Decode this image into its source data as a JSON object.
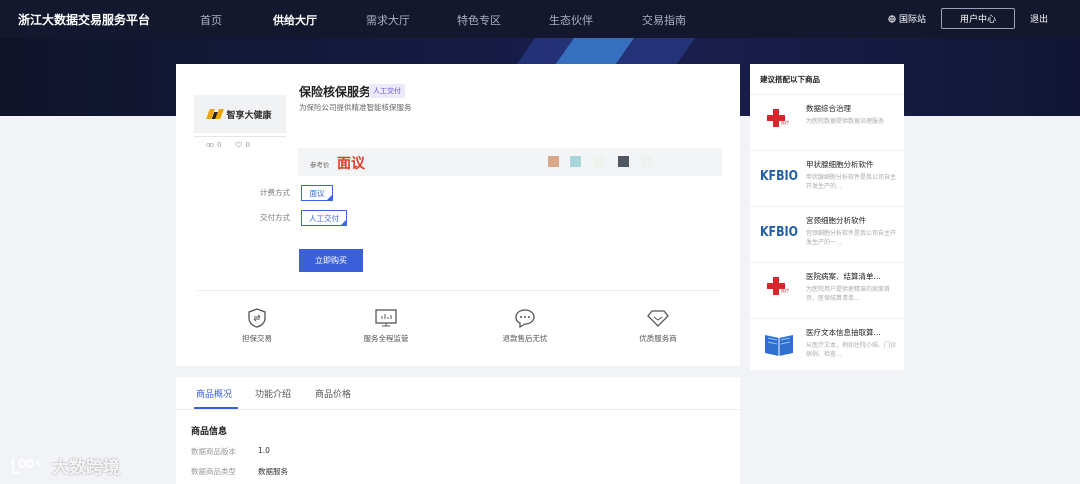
{
  "header": {
    "brand": "浙江大数据交易服务平台",
    "nav": [
      "首页",
      "供给大厅",
      "需求大厅",
      "特色专区",
      "生态伙伴",
      "交易指南"
    ],
    "active_nav": "供给大厅",
    "international": "国际站",
    "user_center": "用户中心",
    "logout": "退出"
  },
  "product": {
    "logo_text": "智享大健康",
    "views": "0",
    "favorites": "0",
    "title": "保险核保服务",
    "tag": "人工交付",
    "subtitle": "为保险公司提供精准智能核保服务",
    "price_label": "参考价",
    "price": "面议",
    "swatch_colors": [
      "#d9a88a",
      "#a9d6da",
      "#eef3ee",
      "#505863",
      "#eef2ef"
    ],
    "billing_label": "计费方式",
    "billing_option": "面议",
    "delivery_label": "交付方式",
    "delivery_option": "人工交付",
    "buy_button": "立即购买",
    "features": [
      {
        "label": "担保交易",
        "icon": "shield-icon"
      },
      {
        "label": "服务全程监管",
        "icon": "monitor-icon"
      },
      {
        "label": "退款售后无忧",
        "icon": "chat-icon"
      },
      {
        "label": "优质服务商",
        "icon": "diamond-icon"
      }
    ]
  },
  "sidebar": {
    "title": "建议搭配以下商品",
    "items": [
      {
        "name": "数据综合治理",
        "desc": "为医院数据提供数据治理服务",
        "thumb": "red-cross-logo"
      },
      {
        "name": "甲状腺细胞分析软件",
        "desc": "甲状腺细胞分析软件是我公司自主开发生产的...",
        "thumb": "kfbio-logo"
      },
      {
        "name": "宫颈细胞分析软件",
        "desc": "宫颈细胞分析软件是我公司自主开发生产的一...",
        "thumb": "kfbio-logo"
      },
      {
        "name": "医院病案、结算清单...",
        "desc": "为医院用户提供更精准的病案首页、医保结算清单...",
        "thumb": "red-cross-logo"
      },
      {
        "name": "医疗文本信息抽取算...",
        "desc": "从医疗文本，例如住院小结、门诊病例、检查...",
        "thumb": "book-icon"
      }
    ]
  },
  "tabs": {
    "items": [
      "商品概况",
      "功能介绍",
      "商品价格"
    ],
    "active": "商品概况"
  },
  "info": {
    "section_title": "商品信息",
    "rows": [
      {
        "label": "数据商品版本",
        "value": "1.0"
      },
      {
        "label": "数据商品类型",
        "value": "数据服务"
      }
    ]
  },
  "watermark": "大数跨境",
  "kfbio_text": "KFBIO",
  "colors": {
    "accent": "#3b5fd8",
    "price": "#e03b2b",
    "nav_bg": "#14182e"
  }
}
